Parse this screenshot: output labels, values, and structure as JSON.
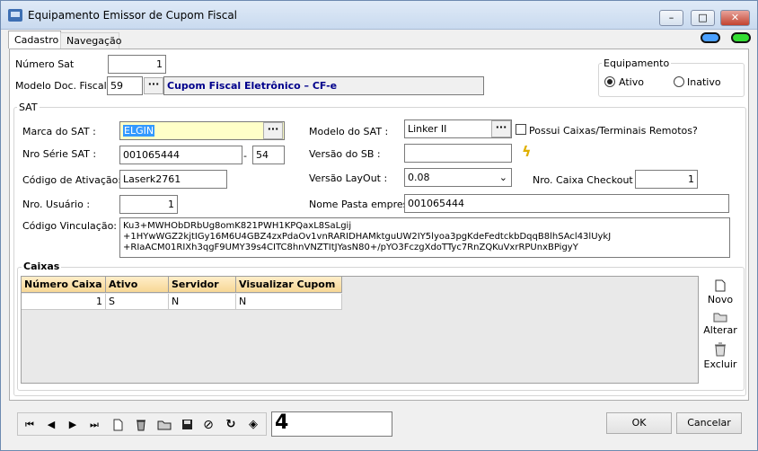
{
  "window": {
    "title": "Equipamento Emissor de Cupom Fiscal",
    "min": "–",
    "max": "□",
    "close": "✕"
  },
  "tabs": [
    {
      "label": "Cadastro"
    },
    {
      "label": "Navegação"
    }
  ],
  "cadastro": {
    "numero_sat_label": "Número Sat",
    "numero_sat": "1",
    "modelo_doc_label": "Modelo Doc. Fiscal :",
    "modelo_doc_code": "59",
    "modelo_doc_desc": "Cupom Fiscal Eletrônico – CF-e"
  },
  "equipamento": {
    "label": "Equipamento",
    "ativo_label": "Ativo",
    "inativo_label": "Inativo",
    "selected": "Ativo"
  },
  "sat": {
    "group_label": "SAT",
    "marca_label": "Marca do SAT :",
    "marca": "ELGIN",
    "modelo_label": "Modelo  do SAT :",
    "modelo": "Linker II",
    "possui_caixas_label": "Possui Caixas/Terminais Remotos?",
    "nro_serie_label": "Nro Série SAT :",
    "nro_serie": "001065444",
    "serie_sep": "-",
    "nro_serie_dv": "54",
    "versao_sb_label": "Versão do SB :",
    "versao_sb": "",
    "codigo_ativacao_label": "Código de Ativação:",
    "codigo_ativacao": "Laserk2761",
    "versao_layout_label": "Versão LayOut :",
    "versao_layout": "0.08",
    "nro_caixa_checkout_label": "Nro.  Caixa Checkout :",
    "nro_caixa_checkout": "1",
    "nro_usuario_label": "Nro.  Usuário :",
    "nro_usuario": "1",
    "nome_pasta_label": "Nome Pasta empresa:",
    "nome_pasta": "001065444",
    "codigo_vinculacao_label": "Código Vinculação:",
    "codigo_vinculacao_lines": [
      "Ku3+MWHObDRbUg8omK821PWH1KPQaxL8SaLgij",
      "+1HYwWGZ2kjtIGy16M6U4GBZ4zxPdaOv1vnRARIDHAMktguUW2IY5lyoa3pgKdeFedtckbDqqB8lhSAcl43lUykJ",
      "+RIaACM01RIXh3qgF9UMY39s4CITC8hnVNZTItJYasN80+/pYO3FczgXdoTTyc7RnZQKuVxrRPUnxBPigyY"
    ]
  },
  "caixas": {
    "label": "Caixas",
    "columns": [
      "Número Caixa",
      "Ativo",
      "Servidor",
      "Visualizar Cupom"
    ],
    "rows": [
      [
        "1",
        "S",
        "N",
        "N"
      ]
    ],
    "novo": "Novo",
    "alterar": "Alterar",
    "excluir": "Excluir"
  },
  "navigator": {
    "first": "first-icon",
    "prev": "prev-icon",
    "next": "next-icon",
    "last": "last-icon",
    "new": "new-doc-icon",
    "delete": "trash-icon",
    "open": "folder-icon",
    "save": "save-icon",
    "cancel": "cancel-icon",
    "refresh": "refresh-icon",
    "filter": "gem-icon",
    "record_indicator": "4"
  },
  "buttons": {
    "ok": "OK",
    "cancelar": "Cancelar"
  },
  "colors": {
    "selected_marca": "#ffffc8",
    "grid_header": "#f7d795",
    "modelo_desc": "#00008b"
  }
}
